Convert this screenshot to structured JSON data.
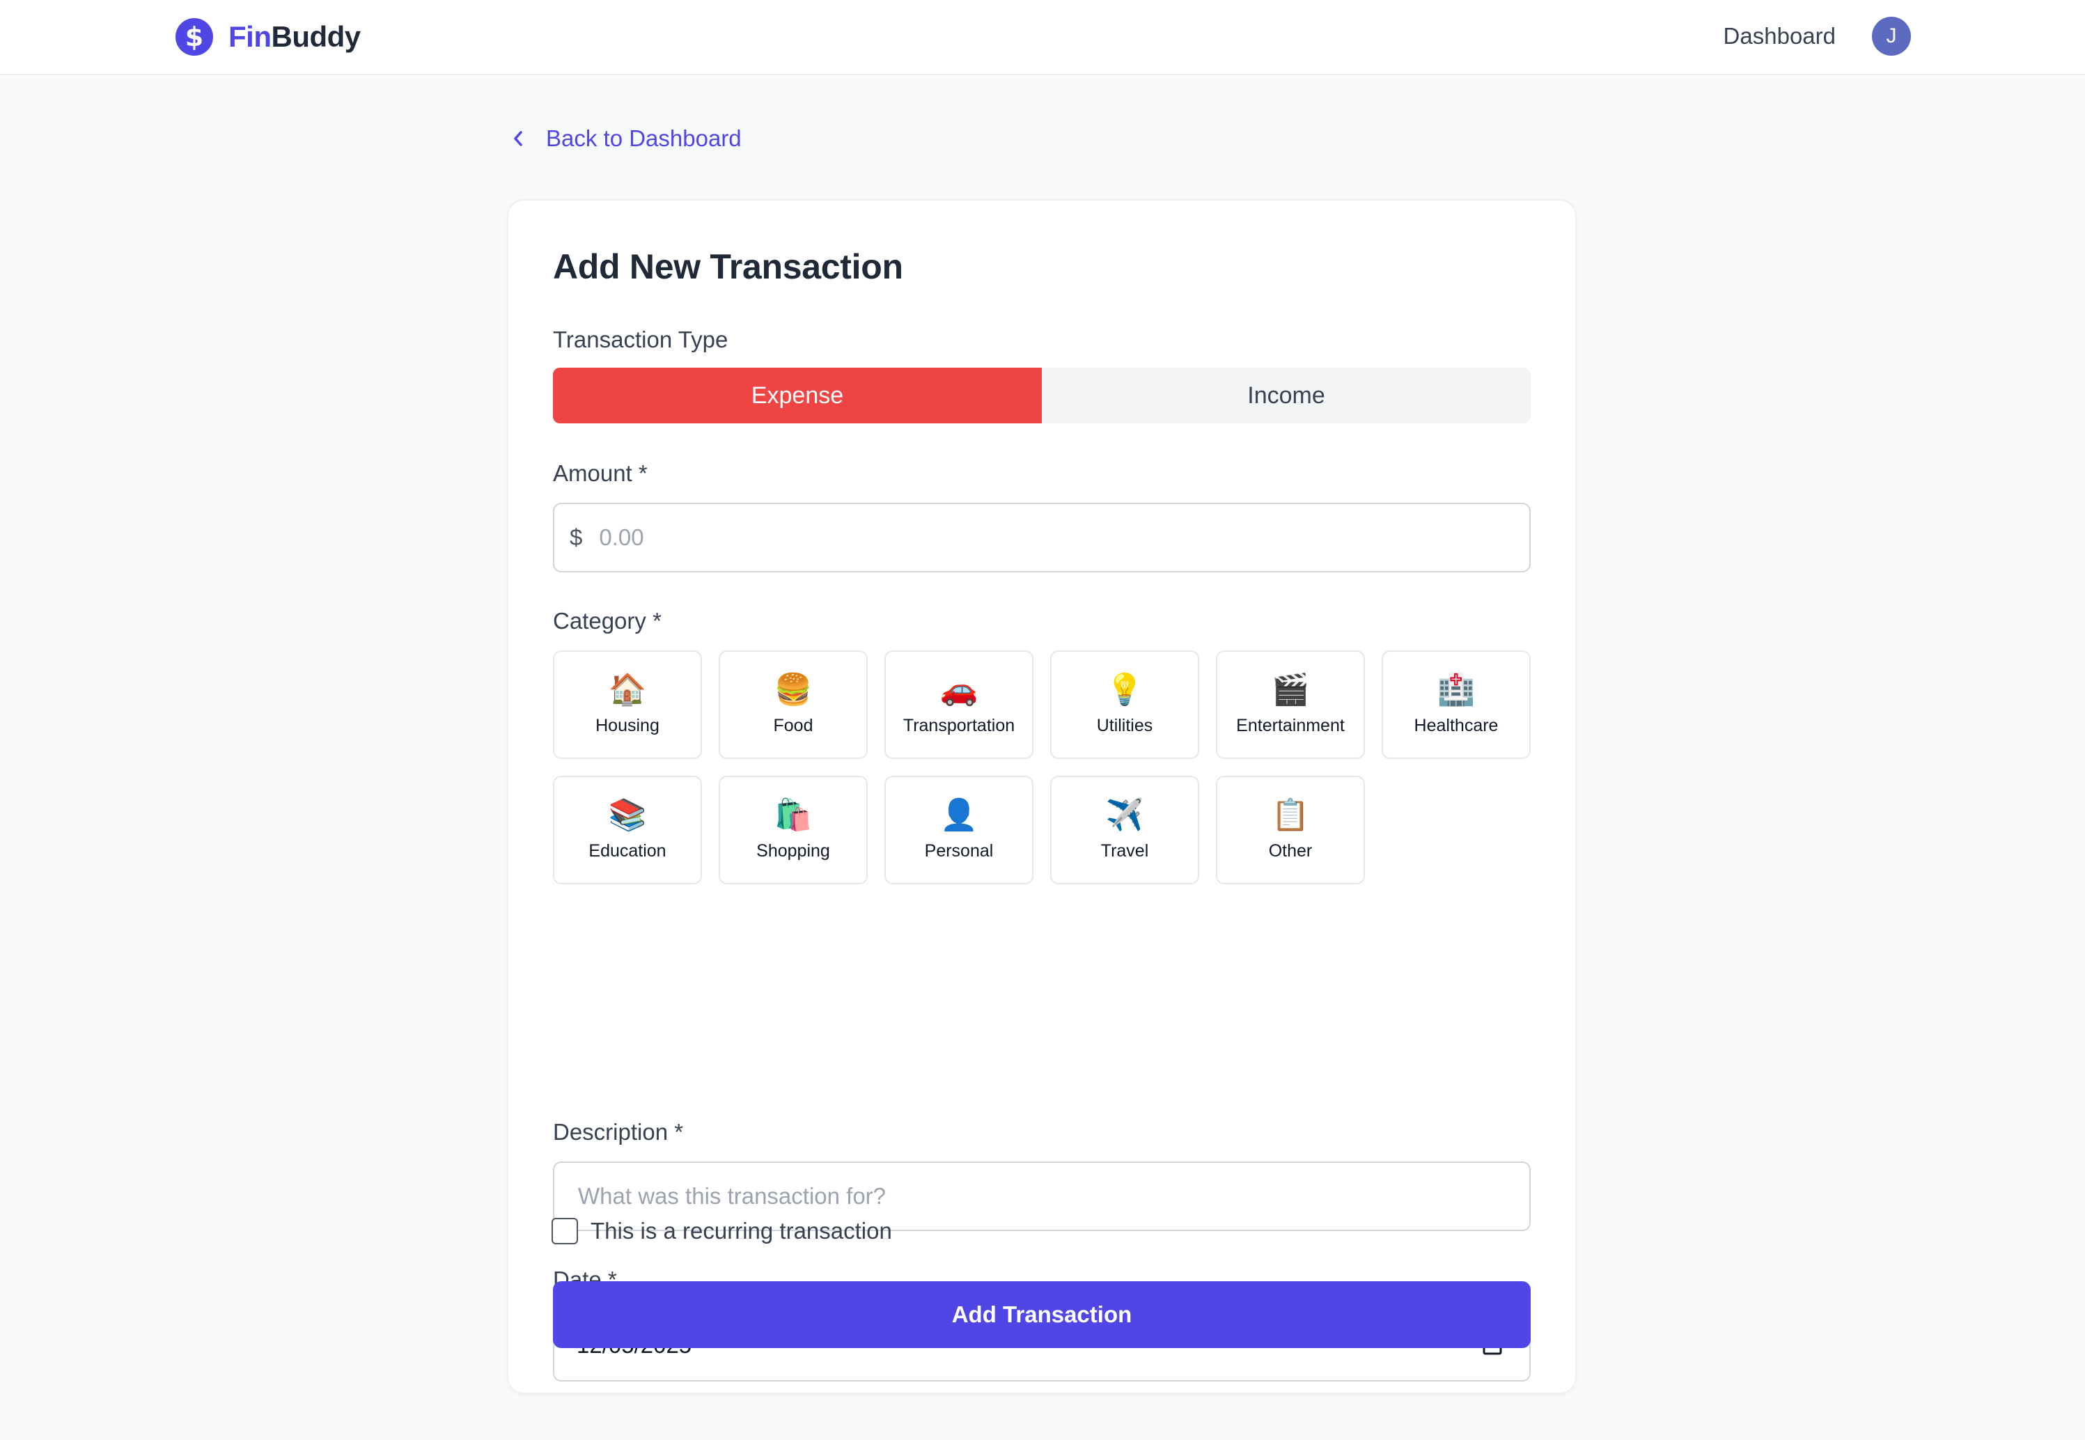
{
  "app": {
    "logo_symbol": "$",
    "brand_part1": "Fin",
    "brand_part2": "Buddy",
    "brand_color": "#4f46e5"
  },
  "header": {
    "nav_dashboard": "Dashboard",
    "avatar_initial": "J"
  },
  "back_link": {
    "label": "Back to Dashboard",
    "icon": "chevron-left-icon"
  },
  "form": {
    "title": "Add New Transaction",
    "type_label": "Transaction Type",
    "type_options": [
      "Expense",
      "Income"
    ],
    "type_selected": "Expense",
    "expense_color": "#ef4444",
    "amount_label": "Amount *",
    "amount_currency": "$",
    "amount_placeholder": "0.00",
    "amount_value": "",
    "category_label": "Category *",
    "categories": [
      {
        "label": "Housing",
        "emoji": "🏠",
        "icon": "house-icon"
      },
      {
        "label": "Food",
        "emoji": "🍔",
        "icon": "burger-icon"
      },
      {
        "label": "Transportation",
        "emoji": "🚗",
        "icon": "car-icon"
      },
      {
        "label": "Utilities",
        "emoji": "💡",
        "icon": "lightbulb-icon"
      },
      {
        "label": "Entertainment",
        "emoji": "🎬",
        "icon": "clapperboard-icon"
      },
      {
        "label": "Healthcare",
        "emoji": "🏥",
        "icon": "hospital-icon"
      },
      {
        "label": "Education",
        "emoji": "📚",
        "icon": "books-icon"
      },
      {
        "label": "Shopping",
        "emoji": "🛍️",
        "icon": "shopping-bags-icon"
      },
      {
        "label": "Personal",
        "emoji": "👤",
        "icon": "person-icon"
      },
      {
        "label": "Travel",
        "emoji": "✈️",
        "icon": "airplane-icon"
      },
      {
        "label": "Other",
        "emoji": "📋",
        "icon": "clipboard-icon"
      }
    ],
    "description_label": "Description *",
    "description_placeholder": "What was this transaction for?",
    "description_value": "",
    "date_label": "Date *",
    "date_value": "12/05/2025",
    "recurring_label": "This is a recurring transaction",
    "recurring_checked": false,
    "submit_label": "Add Transaction",
    "submit_color": "#4f46e5"
  }
}
